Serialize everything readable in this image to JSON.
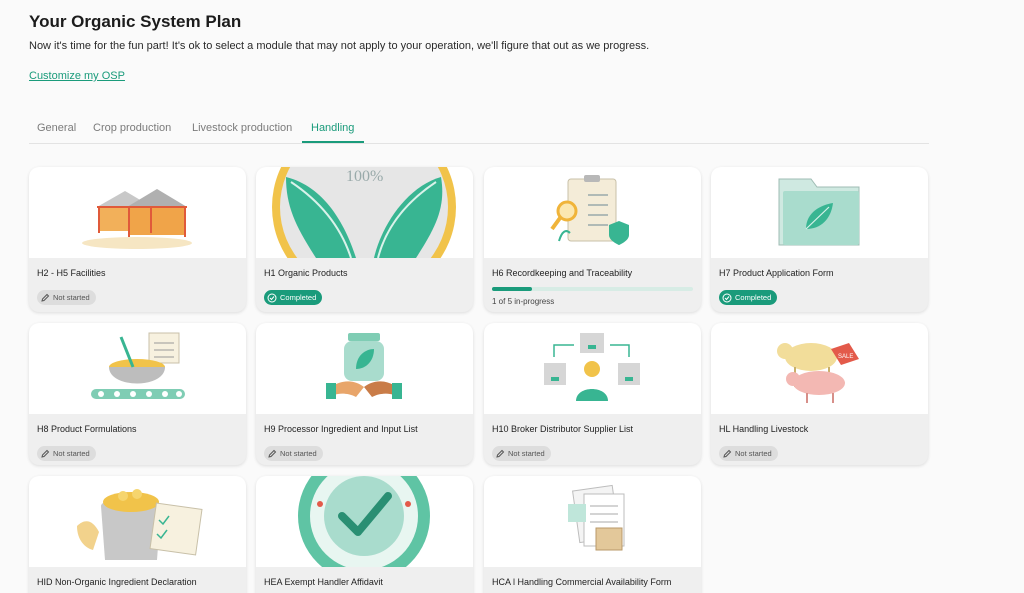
{
  "header": {
    "title": "Your Organic System Plan",
    "subtitle": "Now it's time for the fun part! It's ok to select a module that may not apply to your operation, we'll figure that out as we progress.",
    "customize_link": "Customize my OSP"
  },
  "tabs": [
    {
      "label": "General",
      "active": false
    },
    {
      "label": "Crop production",
      "active": false
    },
    {
      "label": "Livestock production",
      "active": false
    },
    {
      "label": "Handling",
      "active": true
    }
  ],
  "colors": {
    "accent": "#1a9b7b",
    "pill_grey": "#dddddd"
  },
  "modules": [
    {
      "name": "H2 - H5 Facilities",
      "status": "Not started",
      "icon": "facilities-tents-illustration"
    },
    {
      "name": "H1 Organic Products",
      "status": "Completed",
      "icon": "organic-leaf-badge-illustration"
    },
    {
      "name": "H6 Recordkeeping and Traceability",
      "progress_text": "1 of 5 in-progress",
      "progress": 0.2,
      "icon": "clipboard-magnifier-illustration"
    },
    {
      "name": "H7 Product Application Form",
      "status": "Completed",
      "icon": "folder-leaf-illustration"
    },
    {
      "name": "H8 Product Formulations",
      "status": "Not started",
      "icon": "mixing-bowl-conveyor-illustration"
    },
    {
      "name": "H9 Processor Ingredient and Input List",
      "status": "Not started",
      "icon": "jar-handshake-illustration"
    },
    {
      "name": "H10 Broker Distributor Supplier List",
      "status": "Not started",
      "icon": "broker-boxes-illustration"
    },
    {
      "name": "HL Handling Livestock",
      "status": "Not started",
      "icon": "cow-pig-sale-tag-illustration"
    },
    {
      "name": "HID Non-Organic Ingredient Declaration",
      "icon": "grain-sack-checklist-illustration"
    },
    {
      "name": "HEA Exempt Handler Affidavit",
      "icon": "check-seal-illustration"
    },
    {
      "name": "HCA l Handling Commercial Availability Form",
      "icon": "documents-boxes-illustration"
    }
  ]
}
